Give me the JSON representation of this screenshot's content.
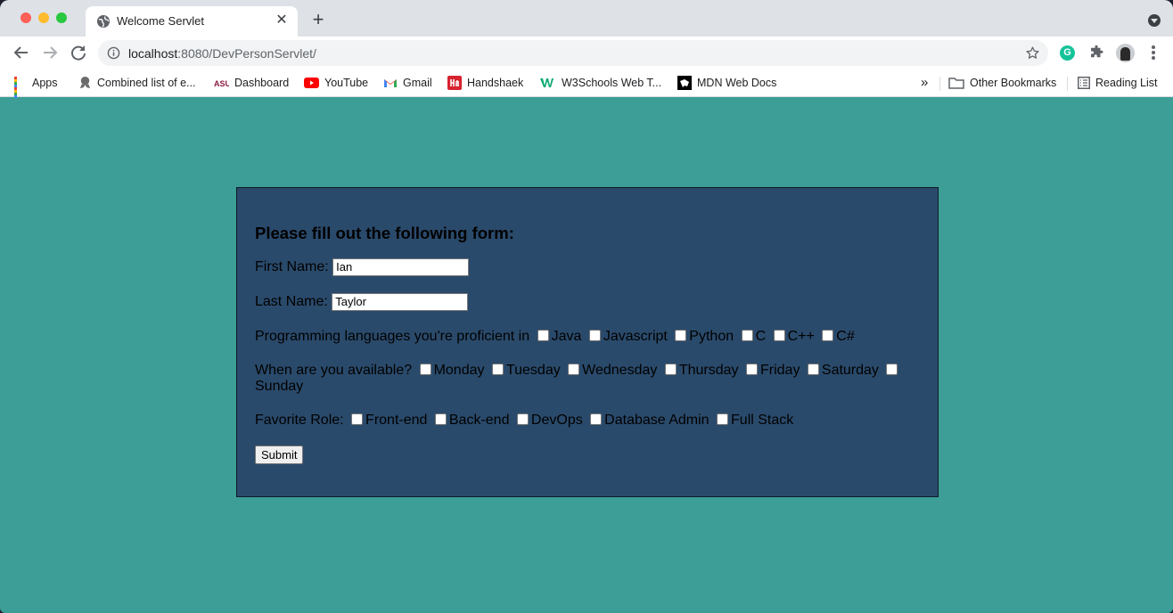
{
  "browser": {
    "tab": {
      "title": "Welcome Servlet",
      "close": "✕"
    },
    "new_tab": "+",
    "url": {
      "host": "localhost",
      "rest": ":8080/DevPersonServlet/"
    },
    "extension_letter": "G",
    "bookmarks": [
      {
        "label": "Apps",
        "icon": "apps-grid-icon"
      },
      {
        "label": "Combined list of e...",
        "icon": "badge-icon"
      },
      {
        "label": "Dashboard",
        "icon": "asu-icon"
      },
      {
        "label": "YouTube",
        "icon": "youtube-icon"
      },
      {
        "label": "Gmail",
        "icon": "gmail-icon"
      },
      {
        "label": "Handshaek",
        "icon": "handshake-icon"
      },
      {
        "label": "W3Schools Web T...",
        "icon": "w3schools-icon"
      },
      {
        "label": "MDN Web Docs",
        "icon": "mdn-icon"
      }
    ],
    "overflow": "»",
    "other_bookmarks": "Other Bookmarks",
    "reading_list": "Reading List"
  },
  "form": {
    "heading": "Please fill out the following form:",
    "first_name": {
      "label": "First Name:",
      "value": "Ian"
    },
    "last_name": {
      "label": "Last Name:",
      "value": "Taylor"
    },
    "languages": {
      "label": "Programming languages you're proficient in",
      "options": [
        "Java",
        "Javascript",
        "Python",
        "C",
        "C++",
        "C#"
      ]
    },
    "availability": {
      "label": "When are you available?",
      "options": [
        "Monday",
        "Tuesday",
        "Wednesday",
        "Thursday",
        "Friday",
        "Saturday",
        "Sunday"
      ]
    },
    "role": {
      "label": "Favorite Role:",
      "options": [
        "Front-end",
        "Back-end",
        "DevOps",
        "Database Admin",
        "Full Stack"
      ]
    },
    "submit": "Submit"
  },
  "colors": {
    "page_bg": "#3c9e96",
    "panel_bg": "#2a4a6b"
  }
}
